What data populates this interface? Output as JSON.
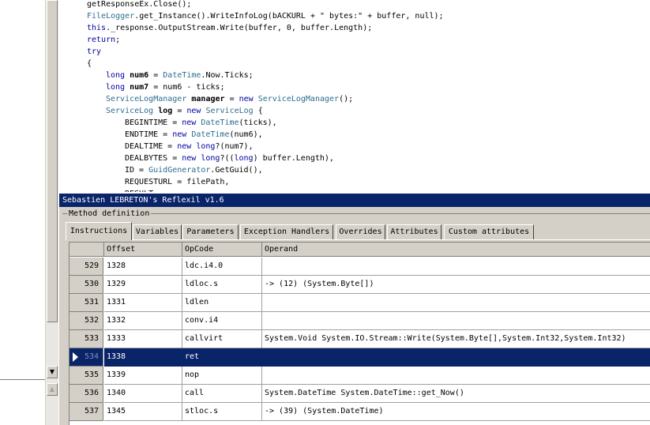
{
  "code": {
    "lines": [
      [
        {
          "t": "getResponseEx.Close();",
          "c": ""
        }
      ],
      [
        {
          "t": "FileLogger",
          "c": "type"
        },
        {
          "t": ".get_Instance().WriteInfoLog(bACKURL + \" bytes:\" + buffer, null);",
          "c": ""
        }
      ],
      [
        {
          "t": "this",
          "c": "kw"
        },
        {
          "t": "._response.OutputStream.Write(buffer, 0, buffer.Length);",
          "c": ""
        }
      ],
      [
        {
          "t": "return",
          "c": "kw"
        },
        {
          "t": ";",
          "c": ""
        }
      ],
      [
        {
          "t": "try",
          "c": "kw"
        }
      ],
      [
        {
          "t": "{",
          "c": ""
        }
      ],
      [
        {
          "t": "long",
          "c": "kw"
        },
        {
          "t": " ",
          "c": ""
        },
        {
          "t": "num6",
          "c": "var"
        },
        {
          "t": " = ",
          "c": ""
        },
        {
          "t": "DateTime",
          "c": "type"
        },
        {
          "t": ".Now.Ticks;",
          "c": ""
        }
      ],
      [
        {
          "t": "long",
          "c": "kw"
        },
        {
          "t": " ",
          "c": ""
        },
        {
          "t": "num7",
          "c": "var"
        },
        {
          "t": " = num6 - ticks;",
          "c": ""
        }
      ],
      [
        {
          "t": "ServiceLogManager",
          "c": "type"
        },
        {
          "t": " ",
          "c": ""
        },
        {
          "t": "manager",
          "c": "var"
        },
        {
          "t": " = ",
          "c": ""
        },
        {
          "t": "new",
          "c": "kw"
        },
        {
          "t": " ",
          "c": ""
        },
        {
          "t": "ServiceLogManager",
          "c": "type"
        },
        {
          "t": "();",
          "c": ""
        }
      ],
      [
        {
          "t": "ServiceLog",
          "c": "type"
        },
        {
          "t": " ",
          "c": ""
        },
        {
          "t": "log",
          "c": "var"
        },
        {
          "t": " = ",
          "c": ""
        },
        {
          "t": "new",
          "c": "kw"
        },
        {
          "t": " ",
          "c": ""
        },
        {
          "t": "ServiceLog",
          "c": "type"
        },
        {
          "t": " {",
          "c": ""
        }
      ],
      [
        {
          "t": "BEGINTIME = ",
          "c": ""
        },
        {
          "t": "new",
          "c": "kw"
        },
        {
          "t": " ",
          "c": ""
        },
        {
          "t": "DateTime",
          "c": "type"
        },
        {
          "t": "(ticks),",
          "c": ""
        }
      ],
      [
        {
          "t": "ENDTIME = ",
          "c": ""
        },
        {
          "t": "new",
          "c": "kw"
        },
        {
          "t": " ",
          "c": ""
        },
        {
          "t": "DateTime",
          "c": "type"
        },
        {
          "t": "(num6),",
          "c": ""
        }
      ],
      [
        {
          "t": "DEALTIME = ",
          "c": ""
        },
        {
          "t": "new",
          "c": "kw"
        },
        {
          "t": " ",
          "c": ""
        },
        {
          "t": "long",
          "c": "kw"
        },
        {
          "t": "?(num7),",
          "c": ""
        }
      ],
      [
        {
          "t": "DEALBYTES = ",
          "c": ""
        },
        {
          "t": "new",
          "c": "kw"
        },
        {
          "t": " ",
          "c": ""
        },
        {
          "t": "long",
          "c": "kw"
        },
        {
          "t": "?((",
          "c": ""
        },
        {
          "t": "long",
          "c": "kw"
        },
        {
          "t": ") buffer.Length),",
          "c": ""
        }
      ],
      [
        {
          "t": "ID = ",
          "c": ""
        },
        {
          "t": "GuidGenerator",
          "c": "type"
        },
        {
          "t": ".GetGuid(),",
          "c": ""
        }
      ],
      [
        {
          "t": "REQUESTURL = filePath,",
          "c": ""
        }
      ],
      [
        {
          "t": "RESULT = ",
          "c": ""
        }
      ]
    ]
  },
  "reflexil": {
    "title": "Sebastien LEBRETON's Reflexil v1.6",
    "group_label": "Method definition",
    "tabs": [
      "Instructions",
      "Variables",
      "Parameters",
      "Exception Handlers",
      "Overrides",
      "Attributes",
      "Custom attributes"
    ],
    "active_tab": 0,
    "columns": [
      "Offset",
      "OpCode",
      "Operand"
    ],
    "rows": [
      {
        "index": "529",
        "offset": "1328",
        "opcode": "ldc.i4.0",
        "operand": ""
      },
      {
        "index": "530",
        "offset": "1329",
        "opcode": "ldloc.s",
        "operand": "-> (12)  (System.Byte[])"
      },
      {
        "index": "531",
        "offset": "1331",
        "opcode": "ldlen",
        "operand": ""
      },
      {
        "index": "532",
        "offset": "1332",
        "opcode": "conv.i4",
        "operand": ""
      },
      {
        "index": "533",
        "offset": "1333",
        "opcode": "callvirt",
        "operand": "System.Void System.IO.Stream::Write(System.Byte[],System.Int32,System.Int32)"
      },
      {
        "index": "534",
        "offset": "1338",
        "opcode": "ret",
        "operand": ""
      },
      {
        "index": "535",
        "offset": "1339",
        "opcode": "nop",
        "operand": ""
      },
      {
        "index": "536",
        "offset": "1340",
        "opcode": "call",
        "operand": "System.DateTime System.DateTime::get_Now()"
      },
      {
        "index": "537",
        "offset": "1345",
        "opcode": "stloc.s",
        "operand": "-> (39)  (System.DateTime)"
      }
    ],
    "selected_row": 5
  },
  "colors": {
    "selection": "#0a246a",
    "title_bar": "#0a246a",
    "type_token": "#2b6e8f",
    "keyword_token": "#0000a0",
    "panel": "#d4d0c8"
  },
  "icons": {
    "scroll_down": "scroll-down-arrow-icon",
    "scroll_up": "scroll-up-arrow-icon",
    "row_pointer": "current-row-pointer-icon"
  }
}
